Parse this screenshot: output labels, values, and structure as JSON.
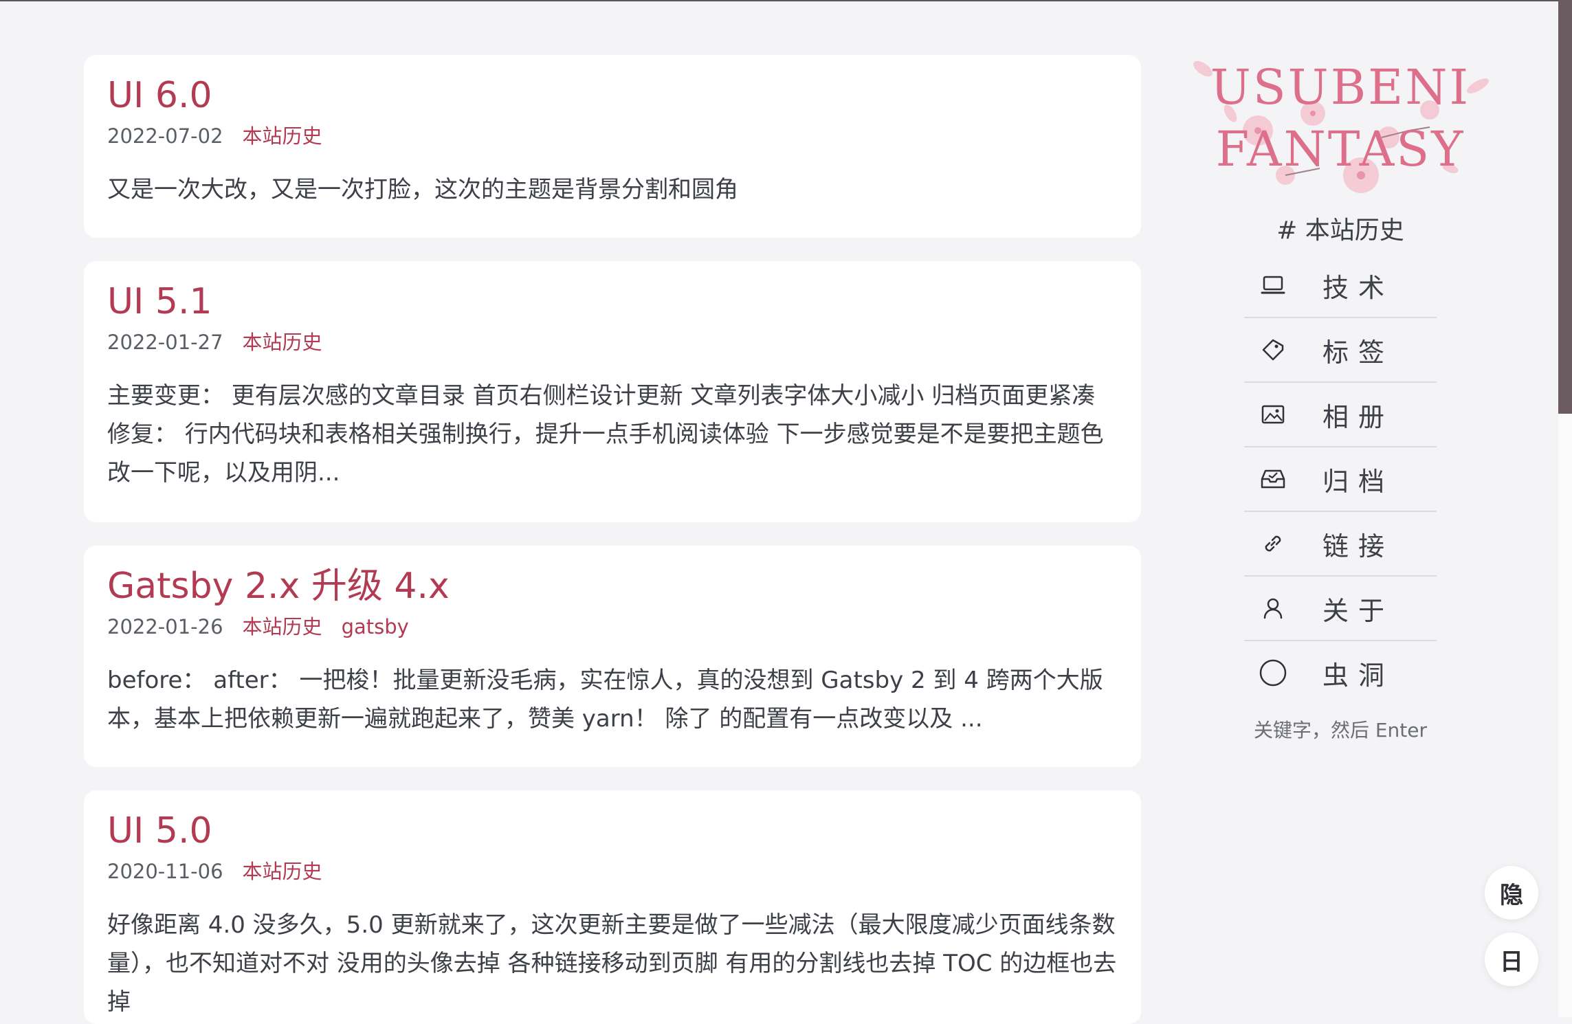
{
  "posts": [
    {
      "title": "UI 6.0",
      "date": "2022-07-02",
      "tags": [
        "本站历史"
      ],
      "excerpt": "又是一次大改，又是一次打脸，这次的主题是背景分割和圆角"
    },
    {
      "title": "UI 5.1",
      "date": "2022-01-27",
      "tags": [
        "本站历史"
      ],
      "excerpt": "主要变更： 更有层次感的文章目录 首页右侧栏设计更新 文章列表字体大小减小 归档页面更紧凑 修复： 行内代码块和表格相关强制换行，提升一点手机阅读体验 下一步感觉要是不是要把主题色改一下呢，以及用阴..."
    },
    {
      "title": "Gatsby 2.x 升级 4.x",
      "date": "2022-01-26",
      "tags": [
        "本站历史",
        "gatsby"
      ],
      "excerpt": "before： after： 一把梭！批量更新没毛病，实在惊人，真的没想到 Gatsby 2 到 4 跨两个大版本，基本上把依赖更新一遍就跑起来了，赞美 yarn！ 除了 的配置有一点改变以及 ..."
    },
    {
      "title": "UI 5.0",
      "date": "2020-11-06",
      "tags": [
        "本站历史"
      ],
      "excerpt": "好像距离 4.0 没多久，5.0 更新就来了，这次更新主要是做了一些减法（最大限度减少页面线条数量），也不知道对不对 没用的头像去掉 各种链接移动到页脚 有用的分割线也去掉 TOC 的边框也去掉"
    }
  ],
  "sidebar": {
    "logo": {
      "line1": "USUBENI",
      "line2": "FANTASY"
    },
    "current_category": "# 本站历史",
    "nav": [
      {
        "label": "技术",
        "icon": "laptop-icon"
      },
      {
        "label": "标签",
        "icon": "tag-icon"
      },
      {
        "label": "相册",
        "icon": "image-icon"
      },
      {
        "label": "归档",
        "icon": "archive-tray-icon"
      },
      {
        "label": "链接",
        "icon": "link-icon"
      },
      {
        "label": "关于",
        "icon": "user-icon"
      },
      {
        "label": "虫洞",
        "icon": "circle-icon"
      }
    ],
    "search_placeholder": "关键字，然后 Enter"
  },
  "floating_buttons": {
    "hide": "隐",
    "theme": "日"
  },
  "colors": {
    "accent": "#b23a52",
    "logo": "#dd6f8a",
    "background": "#f4f4f7",
    "card": "#ffffff"
  }
}
